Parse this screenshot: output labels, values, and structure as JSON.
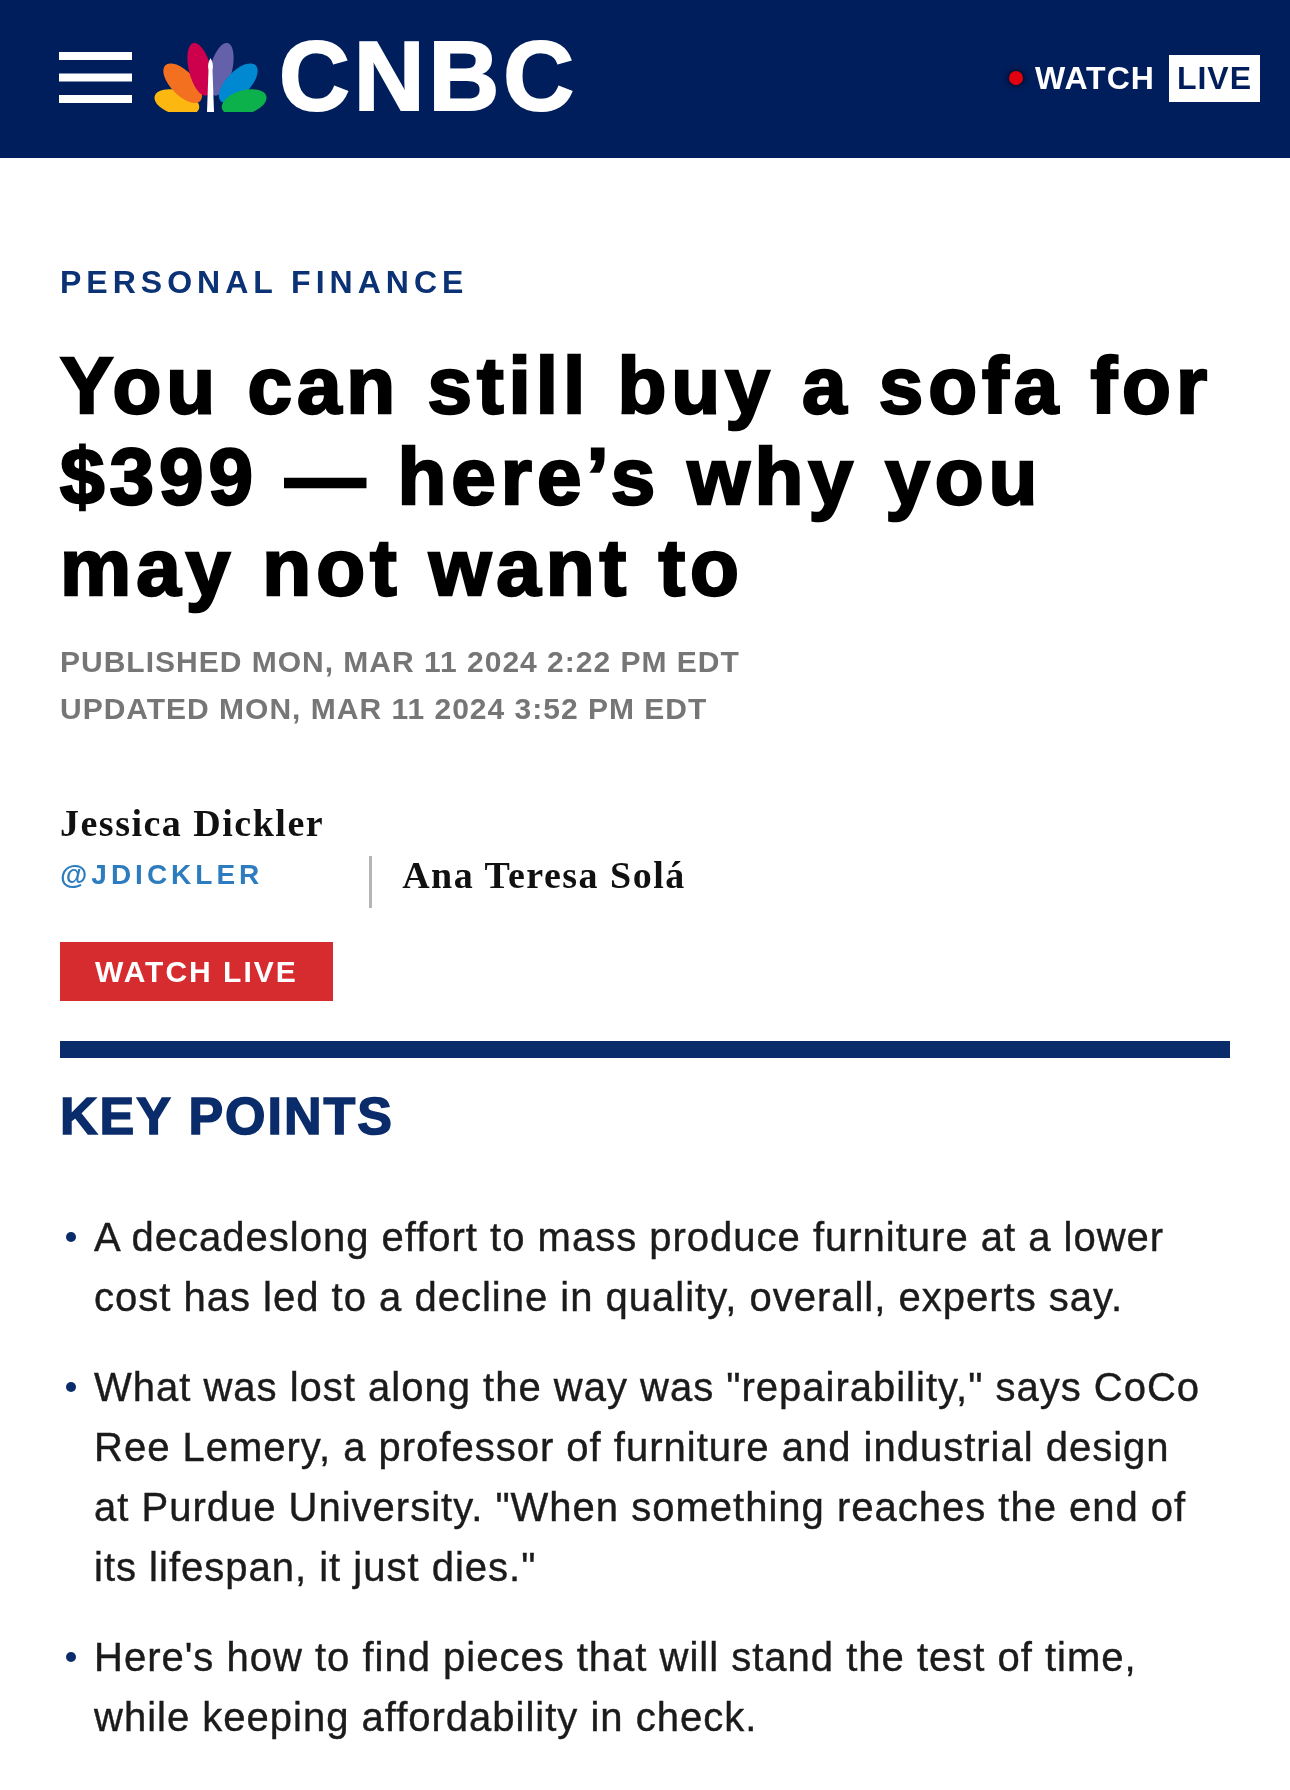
{
  "header": {
    "logo": "CNBC",
    "watch_label": "WATCH",
    "live_badge": "LIVE"
  },
  "article": {
    "section": "PERSONAL FINANCE",
    "headline": "You can still buy a sofa for $399 — here’s why you may not want to",
    "published": "PUBLISHED MON, MAR 11 2024 2:22 PM EDT",
    "updated": "UPDATED MON, MAR 11 2024 3:52 PM EDT",
    "authors": [
      {
        "name": "Jessica Dickler",
        "handle": "@JDICKLER"
      },
      {
        "name": "Ana Teresa Solá"
      }
    ],
    "watch_live_button": "WATCH LIVE"
  },
  "key_points": {
    "title": "KEY POINTS",
    "items": [
      "A decadeslong effort to mass produce furniture at a lower cost has led to a decline in quality, overall, experts say.",
      "What was lost along the way was \"repairability,\" says CoCo Ree Lemery, a professor of furniture and industrial design at Purdue University. \"When something reaches the end of its lifespan, it just dies.\"",
      "Here's how to find pieces that will stand the test of time, while keeping affordability in check."
    ]
  }
}
